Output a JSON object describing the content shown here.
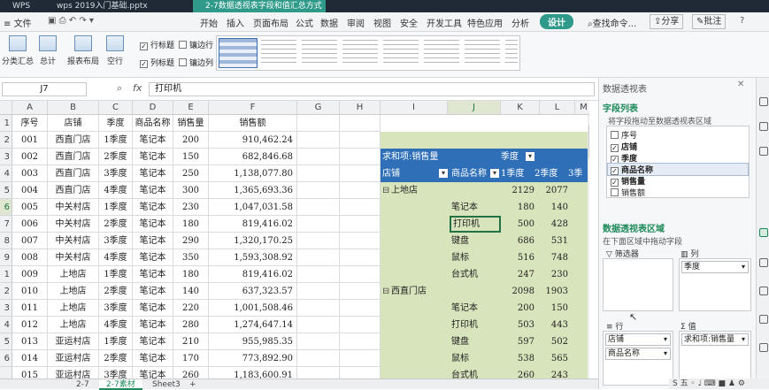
{
  "titlebar": {
    "tabs": [
      "WPS",
      "wps 2019入门基础.pptx",
      "2-7数据透视表字段和值汇总方式"
    ]
  },
  "menubar": {
    "file_label": "文件",
    "items": [
      "开始",
      "插入",
      "页面布局",
      "公式",
      "数据",
      "审阅",
      "视图",
      "安全",
      "开发工具",
      "特色应用",
      "分析"
    ],
    "design_label": "设计",
    "search_label": "查找命令...",
    "share_label": "分享",
    "comment_label": "批注"
  },
  "ribbon": {
    "buttons": [
      "分类汇总",
      "总计",
      "报表布局",
      "空行"
    ],
    "checkboxes": [
      {
        "label": "行标题",
        "checked": true
      },
      {
        "label": "镶边行",
        "checked": false
      },
      {
        "label": "列标题",
        "checked": true
      },
      {
        "label": "镶边列",
        "checked": false
      }
    ]
  },
  "formula": {
    "cell_ref": "J7",
    "fx": "fx",
    "value": "打印机"
  },
  "columns": [
    "A",
    "B",
    "C",
    "D",
    "E",
    "F",
    "G",
    "H",
    "I",
    "J",
    "K",
    "L",
    "M"
  ],
  "row_numbers": [
    "1",
    "2",
    "3",
    "4",
    "5",
    "6",
    "7",
    "8",
    "9",
    "1",
    "2",
    "3",
    "4",
    "5",
    "6"
  ],
  "table": {
    "headers": [
      "序号",
      "店铺",
      "季度",
      "商品名称",
      "销售量",
      "销售额"
    ],
    "rows": [
      [
        "001",
        "西直门店",
        "1季度",
        "笔记本",
        "200",
        "910,462.24"
      ],
      [
        "002",
        "西直门店",
        "2季度",
        "笔记本",
        "150",
        "682,846.68"
      ],
      [
        "003",
        "西直门店",
        "3季度",
        "笔记本",
        "250",
        "1,138,077.80"
      ],
      [
        "004",
        "西直门店",
        "4季度",
        "笔记本",
        "300",
        "1,365,693.36"
      ],
      [
        "005",
        "中关村店",
        "1季度",
        "笔记本",
        "230",
        "1,047,031.58"
      ],
      [
        "006",
        "中关村店",
        "2季度",
        "笔记本",
        "180",
        "819,416.02"
      ],
      [
        "007",
        "中关村店",
        "3季度",
        "笔记本",
        "290",
        "1,320,170.25"
      ],
      [
        "008",
        "中关村店",
        "4季度",
        "笔记本",
        "350",
        "1,593,308.92"
      ],
      [
        "009",
        "上地店",
        "1季度",
        "笔记本",
        "180",
        "819,416.02"
      ],
      [
        "010",
        "上地店",
        "2季度",
        "笔记本",
        "140",
        "637,323.57"
      ],
      [
        "011",
        "上地店",
        "3季度",
        "笔记本",
        "220",
        "1,001,508.46"
      ],
      [
        "012",
        "上地店",
        "4季度",
        "笔记本",
        "280",
        "1,274,647.14"
      ],
      [
        "013",
        "亚运村店",
        "1季度",
        "笔记本",
        "210",
        "955,985.35"
      ],
      [
        "014",
        "亚运村店",
        "2季度",
        "笔记本",
        "170",
        "773,892.90"
      ],
      [
        "015",
        "亚运村店",
        "3季度",
        "笔记本",
        "260",
        "1,183,600.91"
      ]
    ]
  },
  "pivot": {
    "value_label": "求和项:销售量",
    "col_field": "季度",
    "row_field": "店铺",
    "item_field": "商品名称",
    "col_headers": [
      "1季度",
      "2季度",
      "3季"
    ],
    "groups": [
      {
        "name": "上地店",
        "q1": "2129",
        "q2": "2077",
        "items": [
          {
            "name": "笔记本",
            "q1": "180",
            "q2": "140"
          },
          {
            "name": "打印机",
            "q1": "500",
            "q2": "428"
          },
          {
            "name": "键盘",
            "q1": "686",
            "q2": "531"
          },
          {
            "name": "鼠标",
            "q1": "516",
            "q2": "748"
          },
          {
            "name": "台式机",
            "q1": "247",
            "q2": "230"
          }
        ]
      },
      {
        "name": "西直门店",
        "q1": "2098",
        "q2": "1903",
        "items": [
          {
            "name": "笔记本",
            "q1": "200",
            "q2": "150"
          },
          {
            "name": "打印机",
            "q1": "503",
            "q2": "443"
          },
          {
            "name": "键盘",
            "q1": "597",
            "q2": "502"
          },
          {
            "name": "鼠标",
            "q1": "538",
            "q2": "565"
          },
          {
            "name": "台式机",
            "q1": "260",
            "q2": "243"
          }
        ]
      }
    ]
  },
  "sheets": {
    "tabs": [
      "2-7",
      "2-7素材",
      "Sheet3"
    ],
    "active": 1,
    "add": "+"
  },
  "panel": {
    "title": "数据透视表",
    "field_list_title": "字段列表",
    "field_list_hint": "将字段拖动至数据透视表区域",
    "fields": [
      {
        "label": "序号",
        "checked": false
      },
      {
        "label": "店铺",
        "checked": true
      },
      {
        "label": "季度",
        "checked": true
      },
      {
        "label": "商品名称",
        "checked": true
      },
      {
        "label": "销售量",
        "checked": true
      },
      {
        "label": "销售额",
        "checked": false
      }
    ],
    "area_title": "数据透视表区域",
    "area_hint": "在下面区域中拖动字段",
    "filter_label": "筛选器",
    "column_label": "列",
    "row_label": "行",
    "value_label": "值",
    "column_fields": [
      "季度"
    ],
    "row_fields": [
      "店铺",
      "商品名称"
    ],
    "value_fields": [
      "求和项:销售量"
    ]
  },
  "colors": {
    "titlebar": "#1f2a36",
    "active_tab": "#2f9a8a",
    "pivot_header": "#2e6fb7",
    "pivot_body": "#d8e4bc",
    "selection": "#217346",
    "panel_accent": "#1e8a5a"
  }
}
